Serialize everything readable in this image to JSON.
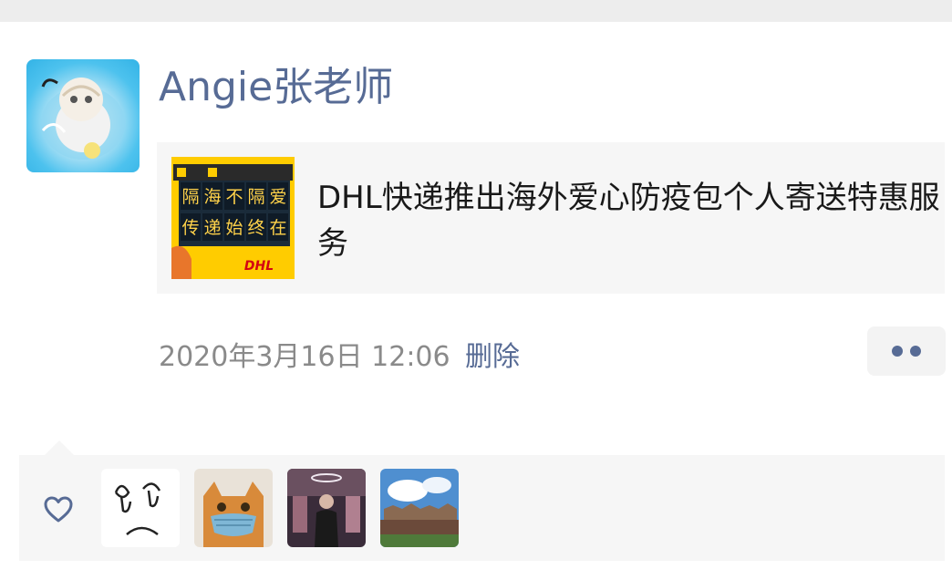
{
  "post": {
    "author": "Angie张老师",
    "link_card": {
      "title": "DHL快递推出海外爱心防疫包个人寄送特惠服务",
      "thumb_line1": [
        "隔",
        "海",
        "不",
        "隔",
        "爱"
      ],
      "thumb_line2": [
        "传",
        "递",
        "始",
        "终",
        "在"
      ],
      "thumb_brand": "DHL"
    },
    "timestamp": "2020年3月16日 12:06",
    "delete_label": "删除"
  },
  "likes": {
    "icon": "heart-outline-icon",
    "avatars": [
      "liker-avatar-drawing",
      "liker-avatar-cat",
      "liker-avatar-person",
      "liker-avatar-landscape"
    ]
  },
  "colors": {
    "accent": "#576b95",
    "card_bg": "#f6f6f6",
    "text": "#191919",
    "muted": "#8a8a8a"
  }
}
